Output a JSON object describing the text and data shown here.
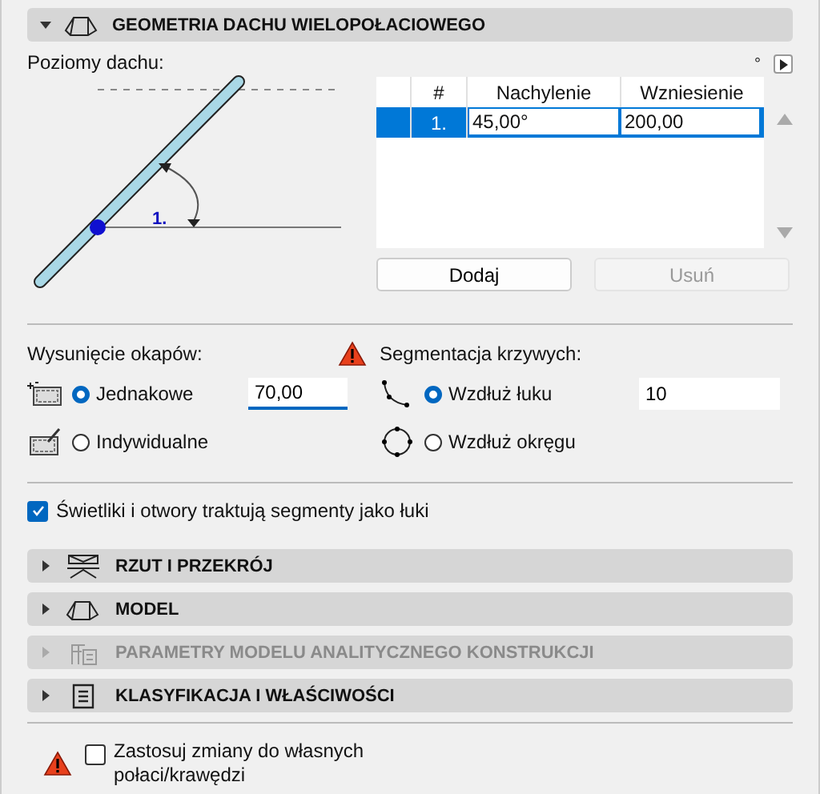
{
  "main_section": {
    "title": "GEOMETRIA DACHU WIELOPOŁACIOWEGO",
    "expanded": true
  },
  "roof_levels": {
    "label": "Poziomy dachu:",
    "unit": "°",
    "diagram_label": "1.",
    "columns": [
      "#",
      "Nachylenie",
      "Wzniesienie"
    ],
    "rows": [
      {
        "index": "1.",
        "slope": "45,00°",
        "rise": "200,00",
        "selected": true
      }
    ],
    "buttons": [
      {
        "label": "Dodaj",
        "disabled": false
      },
      {
        "label": "Usuń",
        "disabled": true
      }
    ]
  },
  "eaves_overhang": {
    "label": "Wysunięcie okapów:",
    "warning": true,
    "value": "70,00",
    "options": [
      {
        "label": "Jednakowe",
        "selected": true
      },
      {
        "label": "Indywidualne",
        "selected": false
      }
    ]
  },
  "curve_segmentation": {
    "label": "Segmentacja krzywych:",
    "value": "10",
    "options": [
      {
        "label": "Wzdłuż łuku",
        "selected": true
      },
      {
        "label": "Wzdłuż okręgu",
        "selected": false
      }
    ]
  },
  "arc_checkbox": {
    "label": "Świetliki i otwory traktują segmenty jako łuki",
    "checked": true
  },
  "sections": [
    {
      "title": "RZUT I PRZEKRÓJ",
      "kind": "plan",
      "expanded": false,
      "disabled": false
    },
    {
      "title": "MODEL",
      "kind": "model",
      "expanded": false,
      "disabled": false
    },
    {
      "title": "PARAMETRY MODELU ANALITYCZNEGO KONSTRUKCJI",
      "kind": "analytic",
      "expanded": false,
      "disabled": true
    },
    {
      "title": "KLASYFIKACJA I WŁAŚCIWOŚCI",
      "kind": "classification",
      "expanded": false,
      "disabled": false
    }
  ],
  "apply_checkbox": {
    "label": "Zastosuj zmiany do własnych połaci/krawędzi",
    "checked": false,
    "warning": true
  }
}
